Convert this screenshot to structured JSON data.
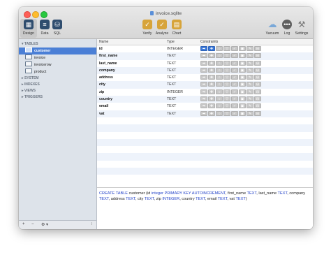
{
  "window": {
    "title": "invoice.sqlite"
  },
  "toolbar": {
    "design": "Design",
    "data": "Data",
    "sql": "SQL",
    "verify": "Verify",
    "analyze": "Analyze",
    "chart": "Chart",
    "vacuum": "Vacuum",
    "log": "Log",
    "settings": "Settings"
  },
  "sidebar": {
    "tables_header": "TABLES",
    "tables": [
      "customer",
      "invoice",
      "invoicerow",
      "product"
    ],
    "system": "SYSTEM",
    "indexes": "INDEXES",
    "views": "VIEWS",
    "triggers": "TRIGGERS",
    "bottom_add": "+",
    "bottom_remove": "−",
    "bottom_gear": "⚙ ▾"
  },
  "columns_header": {
    "name": "Name",
    "type": "Type",
    "constraints": "Constraints"
  },
  "rows": [
    {
      "name": "id",
      "type": "INTEGER"
    },
    {
      "name": "first_name",
      "type": "TEXT"
    },
    {
      "name": "last_name",
      "type": "TEXT"
    },
    {
      "name": "company",
      "type": "TEXT"
    },
    {
      "name": "address",
      "type": "TEXT"
    },
    {
      "name": "city",
      "type": "TEXT"
    },
    {
      "name": "zip",
      "type": "INTEGER"
    },
    {
      "name": "country",
      "type": "TEXT"
    },
    {
      "name": "email",
      "type": "TEXT"
    },
    {
      "name": "vat",
      "type": "TEXT"
    }
  ],
  "sql": {
    "kw1": "CREATE TABLE",
    "t1": " customer (id ",
    "kw2": "integer PRIMARY KEY AUTOINCREMENT",
    "t2": ", first_name ",
    "kw3": "TEXT",
    "t3": ", last_name ",
    "kw4": "TEXT",
    "t4": ", company ",
    "kw5": "TEXT",
    "t5": ", address ",
    "kw6": "TEXT",
    "t6": ", city ",
    "kw7": "TEXT",
    "t7": ", zip ",
    "kw8": "INTEGER",
    "t8": ", country ",
    "kw9": "TEXT",
    "t9": ", email ",
    "kw10": "TEXT",
    "t10": ", vat ",
    "kw11": "TEXT",
    "t11": ")"
  },
  "colors": {
    "selection": "#4a7fd6",
    "keyword": "#1f3fc7",
    "constraint_on": "#3b78d8"
  }
}
